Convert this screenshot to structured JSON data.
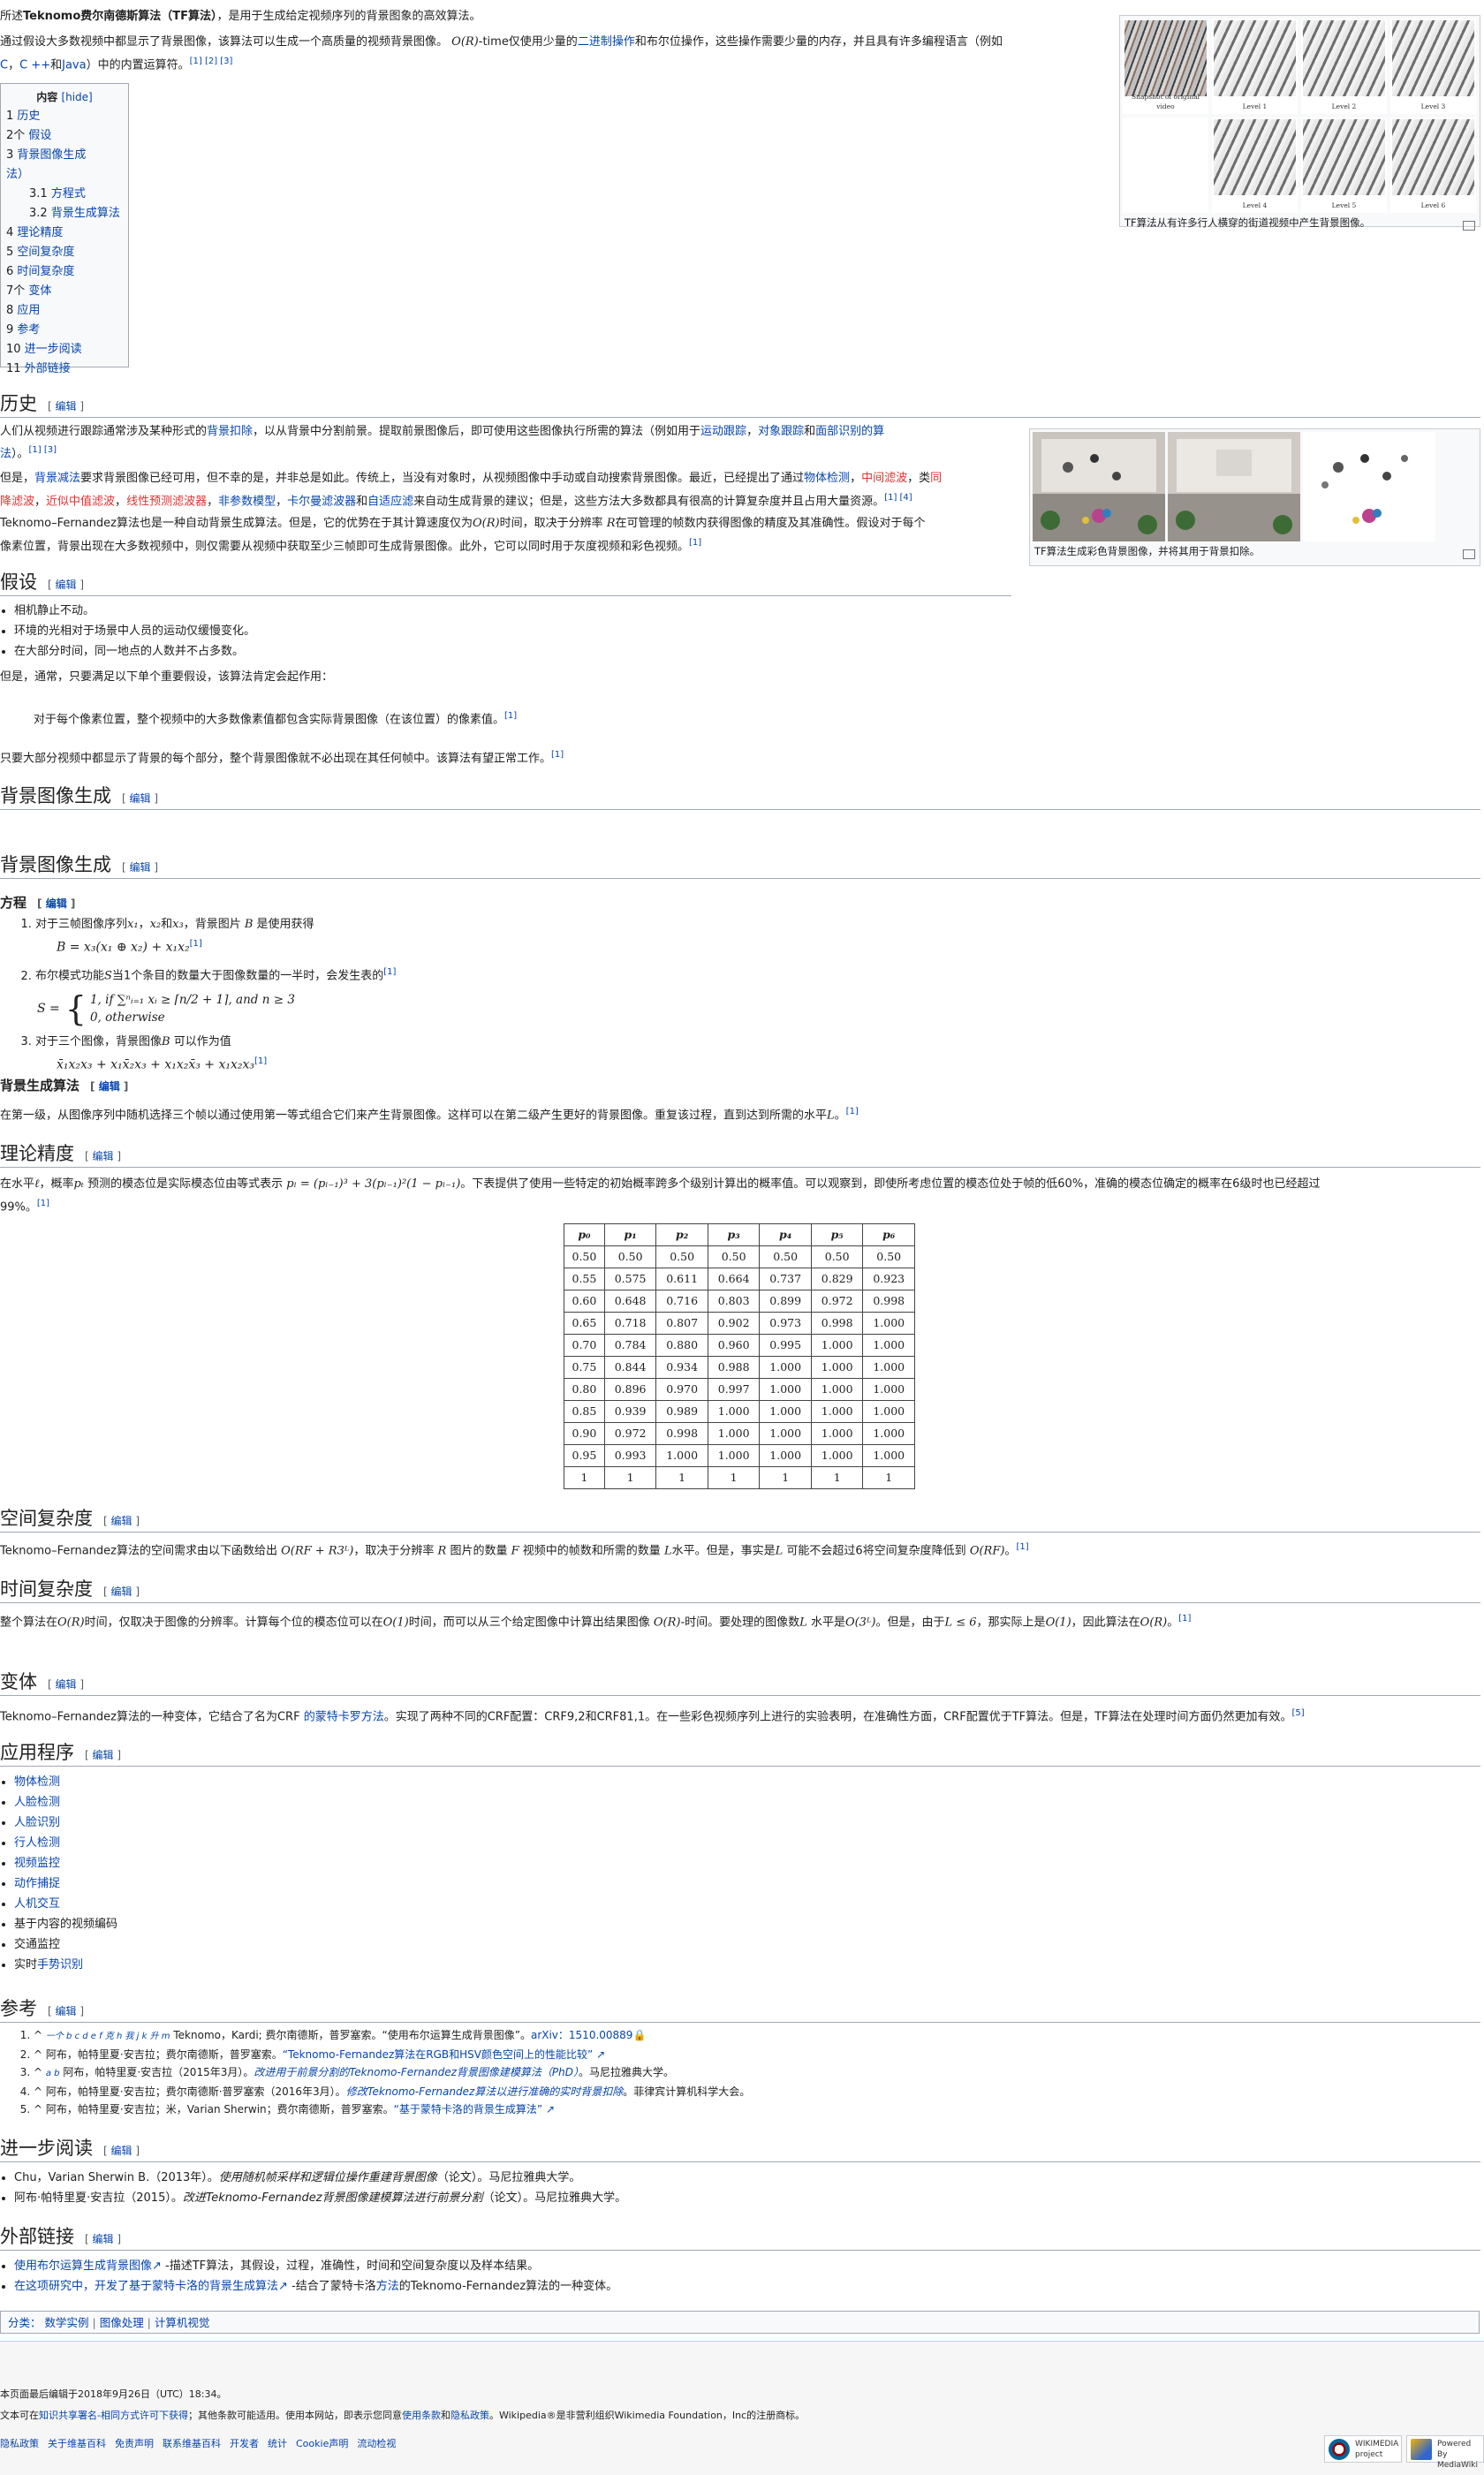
{
  "intro": {
    "line1_pre": "所述",
    "line1_bold": "Teknomo费尔南德斯算法（TF算法）",
    "line1_post": "，是用于生成给定视频序列的背景图象的高效算法。",
    "line2_pre": "通过假设大多数视频中都显示了背景图像，该算法可以生成一个高质量的视频背景图像。",
    "line2_math": "O(R)",
    "line2_mid": "-time仅使用少量的",
    "line2_link1": "二进制操作",
    "line2_mid2": "和布尔位操作，这些操作需要少量的内存，并且具有许多编程语言（例如",
    "line3_link1": "C",
    "line3_sep1": "，",
    "line3_link2": "C ++",
    "line3_sep2": "和",
    "line3_link3": "Java",
    "line3_post": "）中的内置运算符。",
    "line3_refs": "[1] [2] [3]"
  },
  "toc": {
    "title": "内容",
    "hide": "[hide]",
    "items": [
      {
        "num": "1",
        "label": "历史"
      },
      {
        "num": "2个",
        "label": "假设"
      },
      {
        "num": "3",
        "label": "背景图像生成"
      },
      {
        "num": "",
        "label": "法）"
      },
      {
        "num": "3.1",
        "label": "方程式"
      },
      {
        "num": "3.2",
        "label": "背景生成算法"
      },
      {
        "num": "4",
        "label": "理论精度"
      },
      {
        "num": "5",
        "label": "空间复杂度"
      },
      {
        "num": "6",
        "label": "时间复杂度"
      },
      {
        "num": "7个",
        "label": "变体"
      },
      {
        "num": "8",
        "label": "应用"
      },
      {
        "num": "9",
        "label": "参考"
      },
      {
        "num": "10",
        "label": "进一步阅读"
      },
      {
        "num": "11",
        "label": "外部链接"
      }
    ]
  },
  "thumb1": {
    "labels": [
      "Snapshot of original video",
      "Level 1",
      "Level 2",
      "Level 3",
      "",
      "Level 4",
      "Level 5",
      "Level 6"
    ],
    "caption": "TF算法从有许多行人横穿的街道视频中产生背景图像。"
  },
  "thumb2": {
    "caption": "TF算法生成彩色背景图像，并将其用于背景扣除。"
  },
  "edit_label": "编辑",
  "history": {
    "heading": "历史",
    "p1_pre": "人们从视频进行跟踪通常涉及某种形式的",
    "p1_link1": "背景扣除",
    "p1_mid": "，以从背景中分割前景。提取前景图像后，即可使用这些图像执行所需的算法（例如用于",
    "p1_link2": "运动跟踪",
    "p1_sep": "，",
    "p1_link3": "对象跟踪",
    "p1_mid2": "和",
    "p1_link4": "面部识别的算",
    "p1_l2_link": "法",
    "p1_l2_post": "）。",
    "p1_refs": "[1] [3]",
    "p2_pre": "但是，",
    "p2_link1": "背景减法",
    "p2_mid": "要求背景图像已经可用，但不幸的是，并非总是如此。传统上，当没有对象时，从视频图像中手动或自动搜索背景图像。最近，已经提出了通过",
    "p2_link2": "物体检测",
    "p2_sep1": "，",
    "p2_red1": "中间滤波",
    "p2_sep2": "，类",
    "p2_red2": "同",
    "p2_l2_red3": "降滤波",
    "p2_l2_sep1": "，",
    "p2_l2_red4": "近似中值滤波",
    "p2_l2_sep2": "，",
    "p2_l2_red5": "线性预测滤波器",
    "p2_l2_sep3": "，",
    "p2_l2_link3": "非参数模型",
    "p2_l2_sep4": "，",
    "p2_l2_link4": "卡尔曼滤波器",
    "p2_l2_mid": "和",
    "p2_l2_link5": "自适应滤",
    "p2_l2_post": "来自动生成背景的建议；但是，这些方法大多数都具有很高的计算复杂度并且占用大量资源。",
    "p2_refs": "[1] [4]",
    "p3_line1_pre": "Teknomo–Fernandez算法也是一种自动背景生成算法。但是，它的优势在于其计算速度仅为",
    "p3_math1": "O(R)",
    "p3_line1_mid": "时间，取决于分辨率",
    "p3_math2": "R",
    "p3_line1_post": "在可管理的帧数内获得图像的精度及其准确性。假设对于每个",
    "p3_line2": "像素位置，背景出现在大多数视频中，则仅需要从视频中获取至少三帧即可生成背景图像。此外，它可以同时用于灰度视频和彩色视频。",
    "p3_refs": "[1]"
  },
  "assumptions": {
    "heading": "假设",
    "items": [
      "相机静止不动。",
      "环境的光相对于场景中人员的运动仅缓慢变化。",
      "在大部分时间，同一地点的人数并不占多数。"
    ],
    "p1": "但是，通常，只要满足以下单个重要假设，该算法肯定会起作用：",
    "quote": "对于每个像素位置，整个视频中的大多数像素值都包含实际背景图像（在该位置）的像素值。",
    "quote_ref": "[1]",
    "p2": "只要大部分视频中都显示了背景的每个部分，整个背景图像就不必出现在其任何帧中。该算法有望正常工作。",
    "p2_ref": "[1]"
  },
  "bg_generation": {
    "heading": "背景图像生成",
    "heading_dup": "背景图像生成",
    "eq_heading": "方程",
    "eq1_text": "对于三帧图像序列",
    "eq1_x1": "x₁",
    "eq1_sep": "，",
    "eq1_x2": "x₂",
    "eq1_and": "和",
    "eq1_x3": "x₃",
    "eq1_post": "，背景图片",
    "eq1_B": "B",
    "eq1_post2": "是使用获得",
    "eq1_formula": "B = x₃(x₁ ⊕ x₂) + x₁x₂",
    "eq1_ref": "[1]",
    "eq2_text_pre": "布尔模式功能",
    "eq2_S": "S",
    "eq2_text_post": "当1个条目的数量大于图像数量的一半时，会发生表的",
    "eq2_ref": "[1]",
    "eq2_lhs": "S =",
    "eq2_case1": "1,   if ∑ⁿᵢ₌₁ xᵢ ≥ ⌈n/2 + 1⌉, and n ≥ 3",
    "eq2_case2": "0,   otherwise",
    "eq3_text_pre": "对于三个图像，背景图像",
    "eq3_B": "B",
    "eq3_text_post": "可以作为值",
    "eq3_formula": "x̄₁x₂x₃ + x₁x̄₂x₃ + x₁x₂x̄₃ + x₁x₂x₃",
    "eq3_ref": "[1]",
    "alg_heading": "背景生成算法",
    "alg_text": "在第一级，从图像序列中随机选择三个帧以通过使用第一等式组合它们来产生背景图像。这样可以在第二级产生更好的背景图像。重复该过程，直到达到所需的水平",
    "alg_math": "L",
    "alg_post": "。",
    "alg_ref": "[1]"
  },
  "accuracy": {
    "heading": "理论精度",
    "p_pre": "在水平",
    "p_l": "ℓ",
    "p_mid": "，概率",
    "p_pt": "pₜ",
    "p_mid2": "预测的模态位是实际模态位由等式表示",
    "p_formula": "pₗ = (pₗ₋₁)³ + 3(pₗ₋₁)²(1 − pₗ₋₁)",
    "p_post": "。下表提供了使用一些特定的初始概率跨多个级别计算出的概率值。可以观察到，即使所考虑位置的模态位处于帧的低60%，准确的模态位确定的概率在6级时也已经超过",
    "p_line2": "99%。",
    "p_ref": "[1]"
  },
  "chart_data": {
    "type": "table",
    "columns": [
      "p₀",
      "p₁",
      "p₂",
      "p₃",
      "p₄",
      "p₅",
      "p₆"
    ],
    "rows": [
      [
        "0.50",
        "0.50",
        "0.50",
        "0.50",
        "0.50",
        "0.50",
        "0.50"
      ],
      [
        "0.55",
        "0.575",
        "0.611",
        "0.664",
        "0.737",
        "0.829",
        "0.923"
      ],
      [
        "0.60",
        "0.648",
        "0.716",
        "0.803",
        "0.899",
        "0.972",
        "0.998"
      ],
      [
        "0.65",
        "0.718",
        "0.807",
        "0.902",
        "0.973",
        "0.998",
        "1.000"
      ],
      [
        "0.70",
        "0.784",
        "0.880",
        "0.960",
        "0.995",
        "1.000",
        "1.000"
      ],
      [
        "0.75",
        "0.844",
        "0.934",
        "0.988",
        "1.000",
        "1.000",
        "1.000"
      ],
      [
        "0.80",
        "0.896",
        "0.970",
        "0.997",
        "1.000",
        "1.000",
        "1.000"
      ],
      [
        "0.85",
        "0.939",
        "0.989",
        "1.000",
        "1.000",
        "1.000",
        "1.000"
      ],
      [
        "0.90",
        "0.972",
        "0.998",
        "1.000",
        "1.000",
        "1.000",
        "1.000"
      ],
      [
        "0.95",
        "0.993",
        "1.000",
        "1.000",
        "1.000",
        "1.000",
        "1.000"
      ],
      [
        "1",
        "1",
        "1",
        "1",
        "1",
        "1",
        "1"
      ]
    ]
  },
  "space": {
    "heading": "空间复杂度",
    "p_pre": "Teknomo–Fernandez算法的空间需求由以下函数给出",
    "p_f1": "O(RF + R3ᴸ)",
    "p_mid": "，取决于分辨率",
    "p_R": "R",
    "p_mid2": "图片的数量",
    "p_F": "F",
    "p_mid3": "视频中的帧数和所需的数量",
    "p_L": "L",
    "p_mid4": "水平。但是，事实是",
    "p_L2": "L",
    "p_mid5": "可能不会超过6将空间复杂度降低到",
    "p_f2": "O(RF)",
    "p_post": "。",
    "p_ref": "[1]"
  },
  "time": {
    "heading": "时间复杂度",
    "p_pre": "整个算法在",
    "p_f1": "O(R)",
    "p_mid": "时间，仅取决于图像的分辨率。计算每个位的模态位可以在",
    "p_f2": "O(1)",
    "p_mid2": "时间，而可以从三个给定图像中计算出结果图像",
    "p_f3": "O(R)",
    "p_mid3": "-时间。要处理的图像数",
    "p_L": "L",
    "p_mid4": "水平是",
    "p_f4": "O(3ᴸ)",
    "p_mid5": "。但是，由于",
    "p_f5": "L ≤ 6",
    "p_mid6": "，那实际上是",
    "p_f6": "O(1)",
    "p_mid7": "，因此算法在",
    "p_f7": "O(R)",
    "p_post": "。",
    "p_ref": "[1]"
  },
  "variants": {
    "heading": "变体",
    "p_pre": "Teknomo–Fernandez算法的一种变体，它结合了名为CRF ",
    "p_link": "的蒙特卡罗方法",
    "p_post": "。实现了两种不同的CRF配置：CRF9,2和CRF81,1。在一些彩色视频序列上进行的实验表明，在准确性方面，CRF配置优于TF算法。但是，TF算法在处理时间方面仍然更加有效。",
    "p_ref": "[5]"
  },
  "applications": {
    "heading": "应用程序",
    "items": [
      {
        "text": "物体检测",
        "link": true
      },
      {
        "text": "人脸检测",
        "link": true
      },
      {
        "text": "人脸识别",
        "link": true
      },
      {
        "text": "行人检测",
        "link": true
      },
      {
        "text": "视频监控",
        "link": true
      },
      {
        "text": "动作捕捉",
        "link": true
      },
      {
        "text": "人机交互",
        "link": true
      },
      {
        "text": "基于内容的视频编码",
        "link": false
      },
      {
        "text": "交通监控",
        "link": false
      },
      {
        "text": "实时",
        "link": false,
        "suffix": "手势识别"
      }
    ]
  },
  "references": {
    "heading": "参考",
    "r1_pre": "^ ",
    "r1_letters": "一个 b c d e f 克 h 我 j k 升 m",
    "r1_text": "Teknomo，Kardi; 费尔南德斯，普罗塞索。“使用布尔运算生成背景图像”。",
    "r1_link": "arXiv：1510.00889",
    "r2_pre": "^ ",
    "r2_text": "阿布，帕特里夏·安吉拉；费尔南德斯，普罗塞索。",
    "r2_link": "“Teknomo-Fernandez算法在RGB和HSV颜色空间上的性能比较”",
    "r3_pre": "^ ",
    "r3_letters": "a b",
    "r3_text": "阿布，帕特里夏·安吉拉（2015年3月）。",
    "r3_link": "改进用于前景分割的Teknomo-Fernandez背景图像建模算法（PhD）",
    "r3_post": "。马尼拉雅典大学。",
    "r4_pre": "^ ",
    "r4_text": "阿布，帕特里夏·安吉拉；费尔南德斯·普罗塞索（2016年3月）。",
    "r4_link": "修改Teknomo-Fernandez算法以进行准确的实时背景扣除",
    "r4_post": "。菲律宾计算机科学大会。",
    "r5_pre": "^ ",
    "r5_text": "阿布，帕特里夏·安吉拉；米，Varian Sherwin；费尔南德斯，普罗塞索。",
    "r5_link": "“基于蒙特卡洛的背景生成算法”"
  },
  "further": {
    "heading": "进一步阅读",
    "i1_pre": "Chu，Varian Sherwin B.（2013年）。",
    "i1_italic": "使用随机帧采样和逻辑位操作重建背景图像",
    "i1_post": "（论文）。马尼拉雅典大学。",
    "i2_pre": "阿布·帕特里夏·安吉拉（2015）。",
    "i2_italic": "改进Teknomo-Fernandez背景图像建模算法进行前景分割",
    "i2_post": "（论文）。马尼拉雅典大学。"
  },
  "external": {
    "heading": "外部链接",
    "i1_link": "使用布尔运算生成背景图像",
    "i1_post": " -描述TF算法，其假设，过程，准确性，时间和空间复杂度以及样本结果。",
    "i2_link1": "在这项研究中，开发了基于蒙特卡洛的背景生成算法",
    "i2_mid": " -结合了蒙特卡洛",
    "i2_link2": "方法",
    "i2_post": "的Teknomo-Fernandez算法的一种变体。"
  },
  "categories": {
    "label": "分类：",
    "items": [
      "数学实例",
      "图像处理",
      "计算机视觉"
    ]
  },
  "footer": {
    "line1": "本页面最后编辑于2018年9月26日（UTC）18:34。",
    "line2_pre": "文本可在",
    "line2_link": "知识共享署名-相同方式许可下获得",
    "line2_mid": "；其他条款可能适用。使用本网站，即表示您同意",
    "line2_link2": "使用条款",
    "line2_and": "和",
    "line2_link3": "隐私政策",
    "line2_post": "。Wikipedia®是非营利组织Wikimedia Foundation，Inc的注册商标。",
    "links": [
      "隐私政策",
      "关于维基百科",
      "免责声明",
      "联系维基百科",
      "开发者",
      "统计",
      "Cookie声明",
      "流动检视"
    ],
    "badge1": "WIKIMEDIA project",
    "badge2": "Powered By MediaWiki"
  }
}
